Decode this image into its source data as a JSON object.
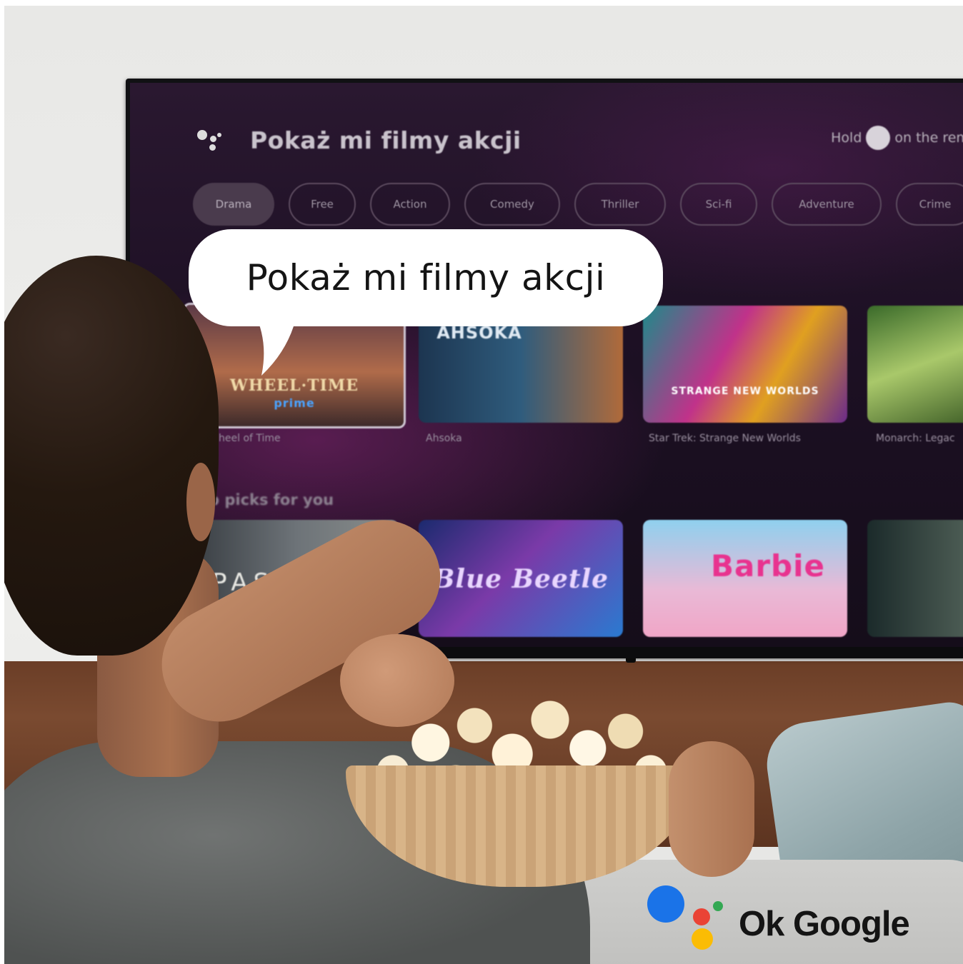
{
  "tv": {
    "assistant_query": "Pokaż mi filmy akcji",
    "hint_prefix": "Hold",
    "hint_suffix": "on the remot",
    "genres": [
      "Drama",
      "Free",
      "Action",
      "Comedy",
      "Thriller",
      "Sci-fi",
      "Adventure",
      "Crime"
    ],
    "active_genre": "Drama",
    "row1_items": [
      {
        "title": "heel of Time",
        "art": "WHEEL·TIME",
        "badge": "prime"
      },
      {
        "title": "Ahsoka",
        "art": "AHSOKA"
      },
      {
        "title": "Star Trek: Strange New Worlds",
        "art": "STRANGE NEW WORLDS"
      },
      {
        "title": "Monarch: Legac"
      }
    ],
    "row2_title": "p picks for you",
    "row2_items": [
      {
        "art": "PAST LIVES"
      },
      {
        "art": "Blue Beetle"
      },
      {
        "art": "Barbie"
      },
      {
        "art": ""
      }
    ]
  },
  "speech_bubble": {
    "text": "Pokaż mi filmy akcji"
  },
  "badge": {
    "label": "Ok Google",
    "colors": {
      "blue": "#1a73e8",
      "red": "#ea4335",
      "yellow": "#fbbc04",
      "green": "#34a853"
    }
  }
}
